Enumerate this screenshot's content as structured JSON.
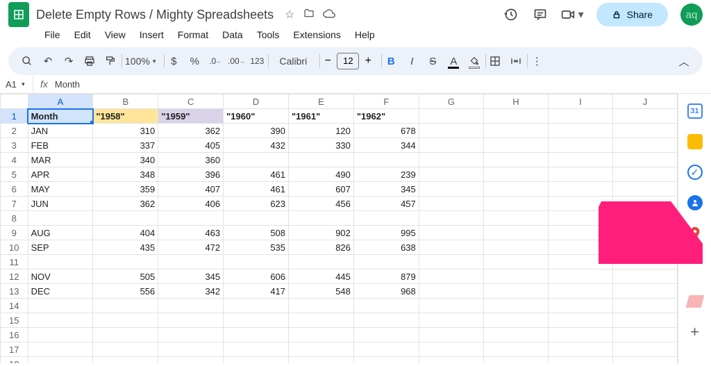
{
  "app": {
    "title": "Delete Empty Rows / Mighty Spreadsheets",
    "share_label": "Share",
    "avatar_initials": "aq"
  },
  "menus": [
    "File",
    "Edit",
    "View",
    "Insert",
    "Format",
    "Data",
    "Tools",
    "Extensions",
    "Help"
  ],
  "toolbar": {
    "zoom": "100%",
    "font": "Calibri",
    "font_size": "12"
  },
  "namebox": "A1",
  "formula": "Month",
  "columns": [
    "A",
    "B",
    "C",
    "D",
    "E",
    "F",
    "G",
    "H",
    "I",
    "J"
  ],
  "header_row": {
    "A": "Month",
    "B": "\"1958\"",
    "C": "\"1959\"",
    "D": "\"1960\"",
    "E": "\"1961\"",
    "F": "\"1962\""
  },
  "rows": [
    {
      "n": 2,
      "A": "JAN",
      "B": "310",
      "C": "362",
      "D": "390",
      "E": "120",
      "F": "678"
    },
    {
      "n": 3,
      "A": "FEB",
      "B": "337",
      "C": "405",
      "D": "432",
      "E": "330",
      "F": "344"
    },
    {
      "n": 4,
      "A": "MAR",
      "B": "340",
      "C": "360",
      "D": "",
      "E": "",
      "F": ""
    },
    {
      "n": 5,
      "A": "APR",
      "B": "348",
      "C": "396",
      "D": "461",
      "E": "490",
      "F": "239"
    },
    {
      "n": 6,
      "A": "MAY",
      "B": "359",
      "C": "407",
      "D": "461",
      "E": "607",
      "F": "345"
    },
    {
      "n": 7,
      "A": "JUN",
      "B": "362",
      "C": "406",
      "D": "623",
      "E": "456",
      "F": "457"
    },
    {
      "n": 8,
      "A": "",
      "B": "",
      "C": "",
      "D": "",
      "E": "",
      "F": ""
    },
    {
      "n": 9,
      "A": "AUG",
      "B": "404",
      "C": "463",
      "D": "508",
      "E": "902",
      "F": "995"
    },
    {
      "n": 10,
      "A": "SEP",
      "B": "435",
      "C": "472",
      "D": "535",
      "E": "826",
      "F": "638"
    },
    {
      "n": 11,
      "A": "",
      "B": "",
      "C": "",
      "D": "",
      "E": "",
      "F": ""
    },
    {
      "n": 12,
      "A": "NOV",
      "B": "505",
      "C": "345",
      "D": "606",
      "E": "445",
      "F": "879"
    },
    {
      "n": 13,
      "A": "DEC",
      "B": "556",
      "C": "342",
      "D": "417",
      "E": "548",
      "F": "968"
    },
    {
      "n": 14,
      "A": "",
      "B": "",
      "C": "",
      "D": "",
      "E": "",
      "F": ""
    },
    {
      "n": 15,
      "A": "",
      "B": "",
      "C": "",
      "D": "",
      "E": "",
      "F": ""
    },
    {
      "n": 16,
      "A": "",
      "B": "",
      "C": "",
      "D": "",
      "E": "",
      "F": ""
    },
    {
      "n": 17,
      "A": "",
      "B": "",
      "C": "",
      "D": "",
      "E": "",
      "F": ""
    },
    {
      "n": 18,
      "A": "",
      "B": "",
      "C": "",
      "D": "",
      "E": "",
      "F": ""
    }
  ],
  "sidepanel": {
    "cal_day": "31"
  }
}
